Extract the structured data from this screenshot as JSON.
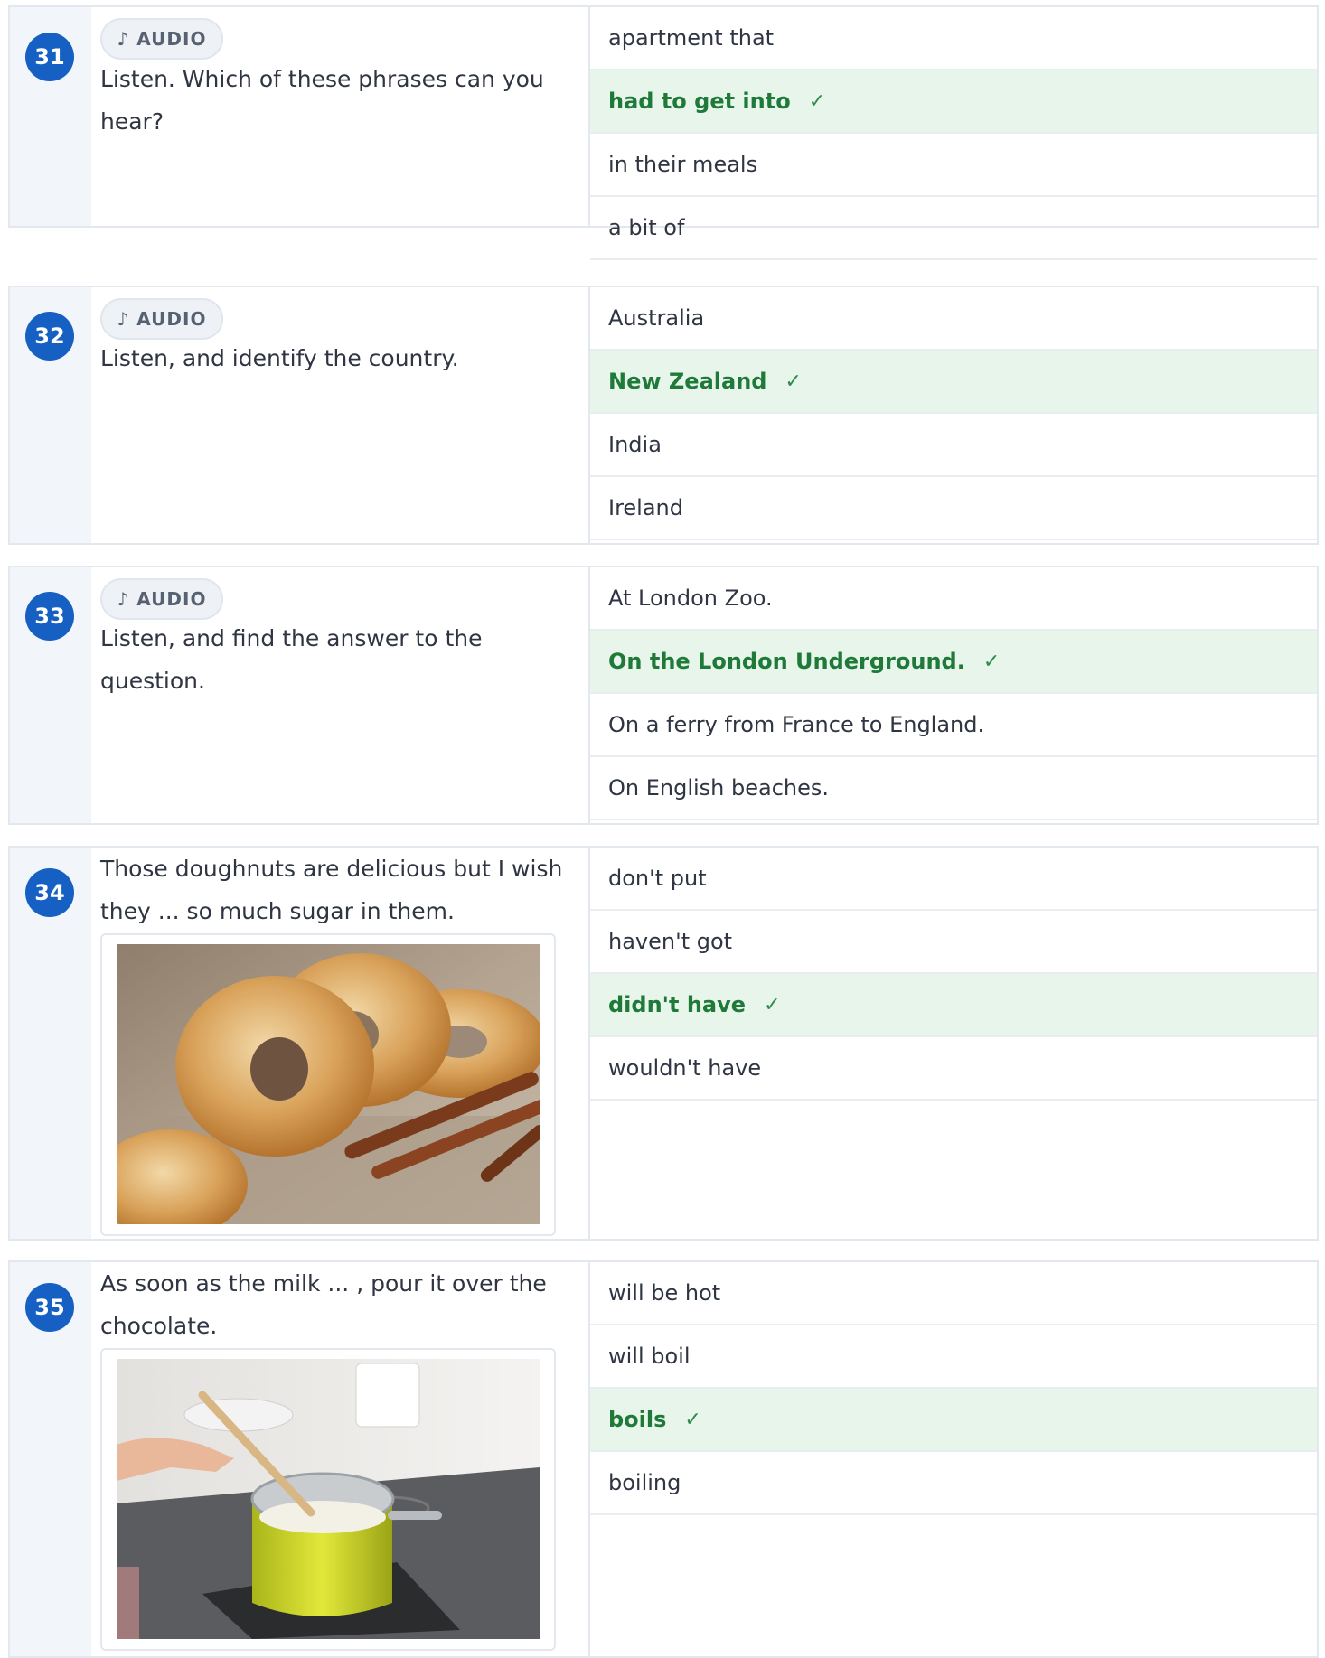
{
  "questions": [
    {
      "number": "31",
      "audio_label": "AUDIO",
      "audio_icon": "♪",
      "prompt_lines": [
        "Listen. Which of these phrases can you",
        "hear?"
      ],
      "options": [
        {
          "text": "apartment that",
          "correct": false
        },
        {
          "text": "had to get into",
          "correct": true
        },
        {
          "text": "in their meals",
          "correct": false
        },
        {
          "text": "a bit of",
          "correct": false
        }
      ]
    },
    {
      "number": "32",
      "audio_label": "AUDIO",
      "audio_icon": "♪",
      "prompt_lines": [
        "Listen, and identify the country."
      ],
      "options": [
        {
          "text": "Australia",
          "correct": false
        },
        {
          "text": "New Zealand",
          "correct": true
        },
        {
          "text": "India",
          "correct": false
        },
        {
          "text": "Ireland",
          "correct": false
        }
      ]
    },
    {
      "number": "33",
      "audio_label": "AUDIO",
      "audio_icon": "♪",
      "prompt_lines": [
        "Listen, and find the answer to the",
        "question."
      ],
      "options": [
        {
          "text": "At London Zoo.",
          "correct": false
        },
        {
          "text": "On the London Underground.",
          "correct": true
        },
        {
          "text": "On a ferry from France to England.",
          "correct": false
        },
        {
          "text": "On English beaches.",
          "correct": false
        }
      ]
    },
    {
      "number": "34",
      "prompt_lines": [
        "Those doughnuts are delicious but I wish",
        "they ... so much sugar in them."
      ],
      "image": "doughnuts-photo",
      "options": [
        {
          "text": "don't put",
          "correct": false
        },
        {
          "text": "haven't got",
          "correct": false
        },
        {
          "text": "didn't have",
          "correct": true
        },
        {
          "text": "wouldn't have",
          "correct": false
        }
      ]
    },
    {
      "number": "35",
      "prompt_lines": [
        "As soon as the milk ... , pour it over the",
        "chocolate."
      ],
      "image": "milk-pot-photo",
      "options": [
        {
          "text": "will be hot",
          "correct": false
        },
        {
          "text": "will boil",
          "correct": false
        },
        {
          "text": "boils",
          "correct": true
        },
        {
          "text": "boiling",
          "correct": false
        }
      ]
    }
  ],
  "check_mark": "✓",
  "colors": {
    "badge": "#1660c3",
    "correct_bg": "#e7f5ea",
    "correct_text": "#1f7a3a",
    "number_column_bg": "#f2f6fb"
  }
}
